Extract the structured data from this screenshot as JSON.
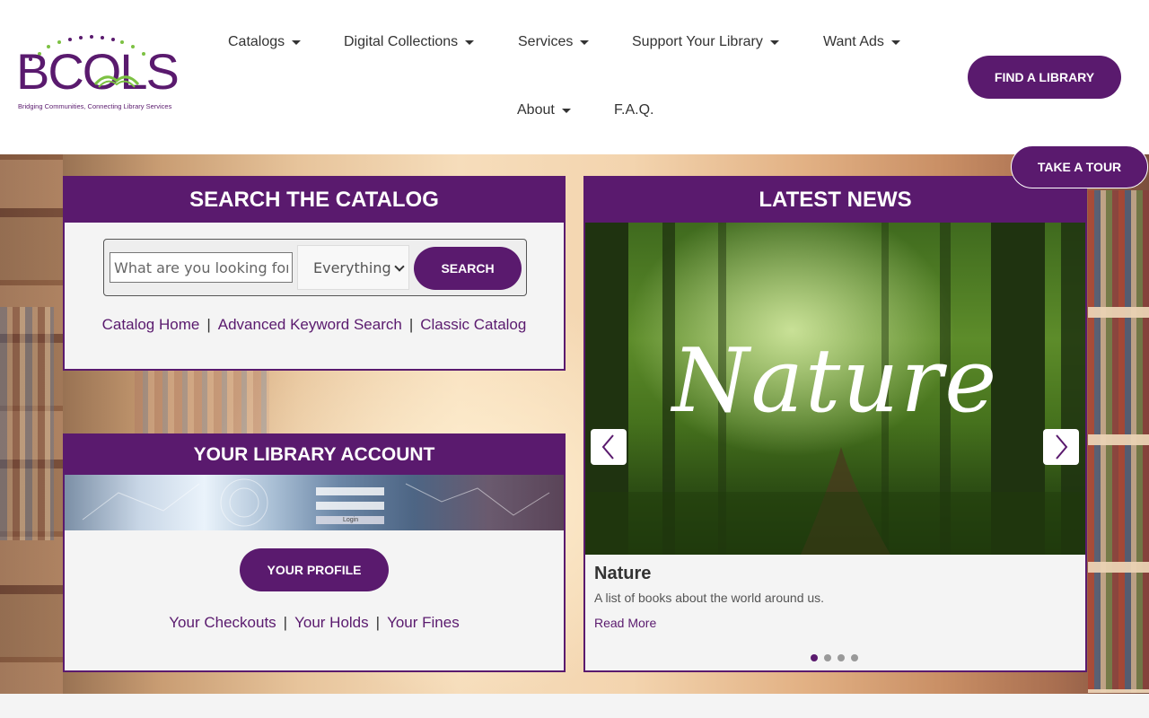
{
  "brand": {
    "logo_text": "BCOLS",
    "tagline": "Bridging Communities, Connecting Library Services",
    "accent_color": "#5a1a6e",
    "dot_color": "#7cc142"
  },
  "nav": {
    "items": [
      {
        "label": "Catalogs",
        "has_dropdown": true
      },
      {
        "label": "Digital Collections",
        "has_dropdown": true
      },
      {
        "label": "Services",
        "has_dropdown": true
      },
      {
        "label": "Support Your Library",
        "has_dropdown": true
      },
      {
        "label": "Want Ads",
        "has_dropdown": true
      },
      {
        "label": "About",
        "has_dropdown": true
      },
      {
        "label": "F.A.Q.",
        "has_dropdown": false
      }
    ],
    "find_library_label": "FIND A LIBRARY"
  },
  "tour": {
    "label": "TAKE A TOUR"
  },
  "search": {
    "title": "SEARCH THE CATALOG",
    "placeholder": "What are you looking for?",
    "scope_selected": "Everything",
    "button_label": "SEARCH",
    "links": [
      "Catalog Home",
      "Advanced Keyword Search",
      "Classic Catalog"
    ]
  },
  "account": {
    "title": "YOUR LIBRARY ACCOUNT",
    "banner_login_text": "Login",
    "profile_button": "YOUR PROFILE",
    "links": [
      "Your Checkouts",
      "Your Holds",
      "Your Fines"
    ]
  },
  "news": {
    "title": "LATEST NEWS",
    "slide_art_text": "Nature",
    "item_title": "Nature",
    "item_description": "A list of books about the world around us.",
    "read_more": "Read More",
    "slide_count": 4,
    "active_slide": 1
  }
}
